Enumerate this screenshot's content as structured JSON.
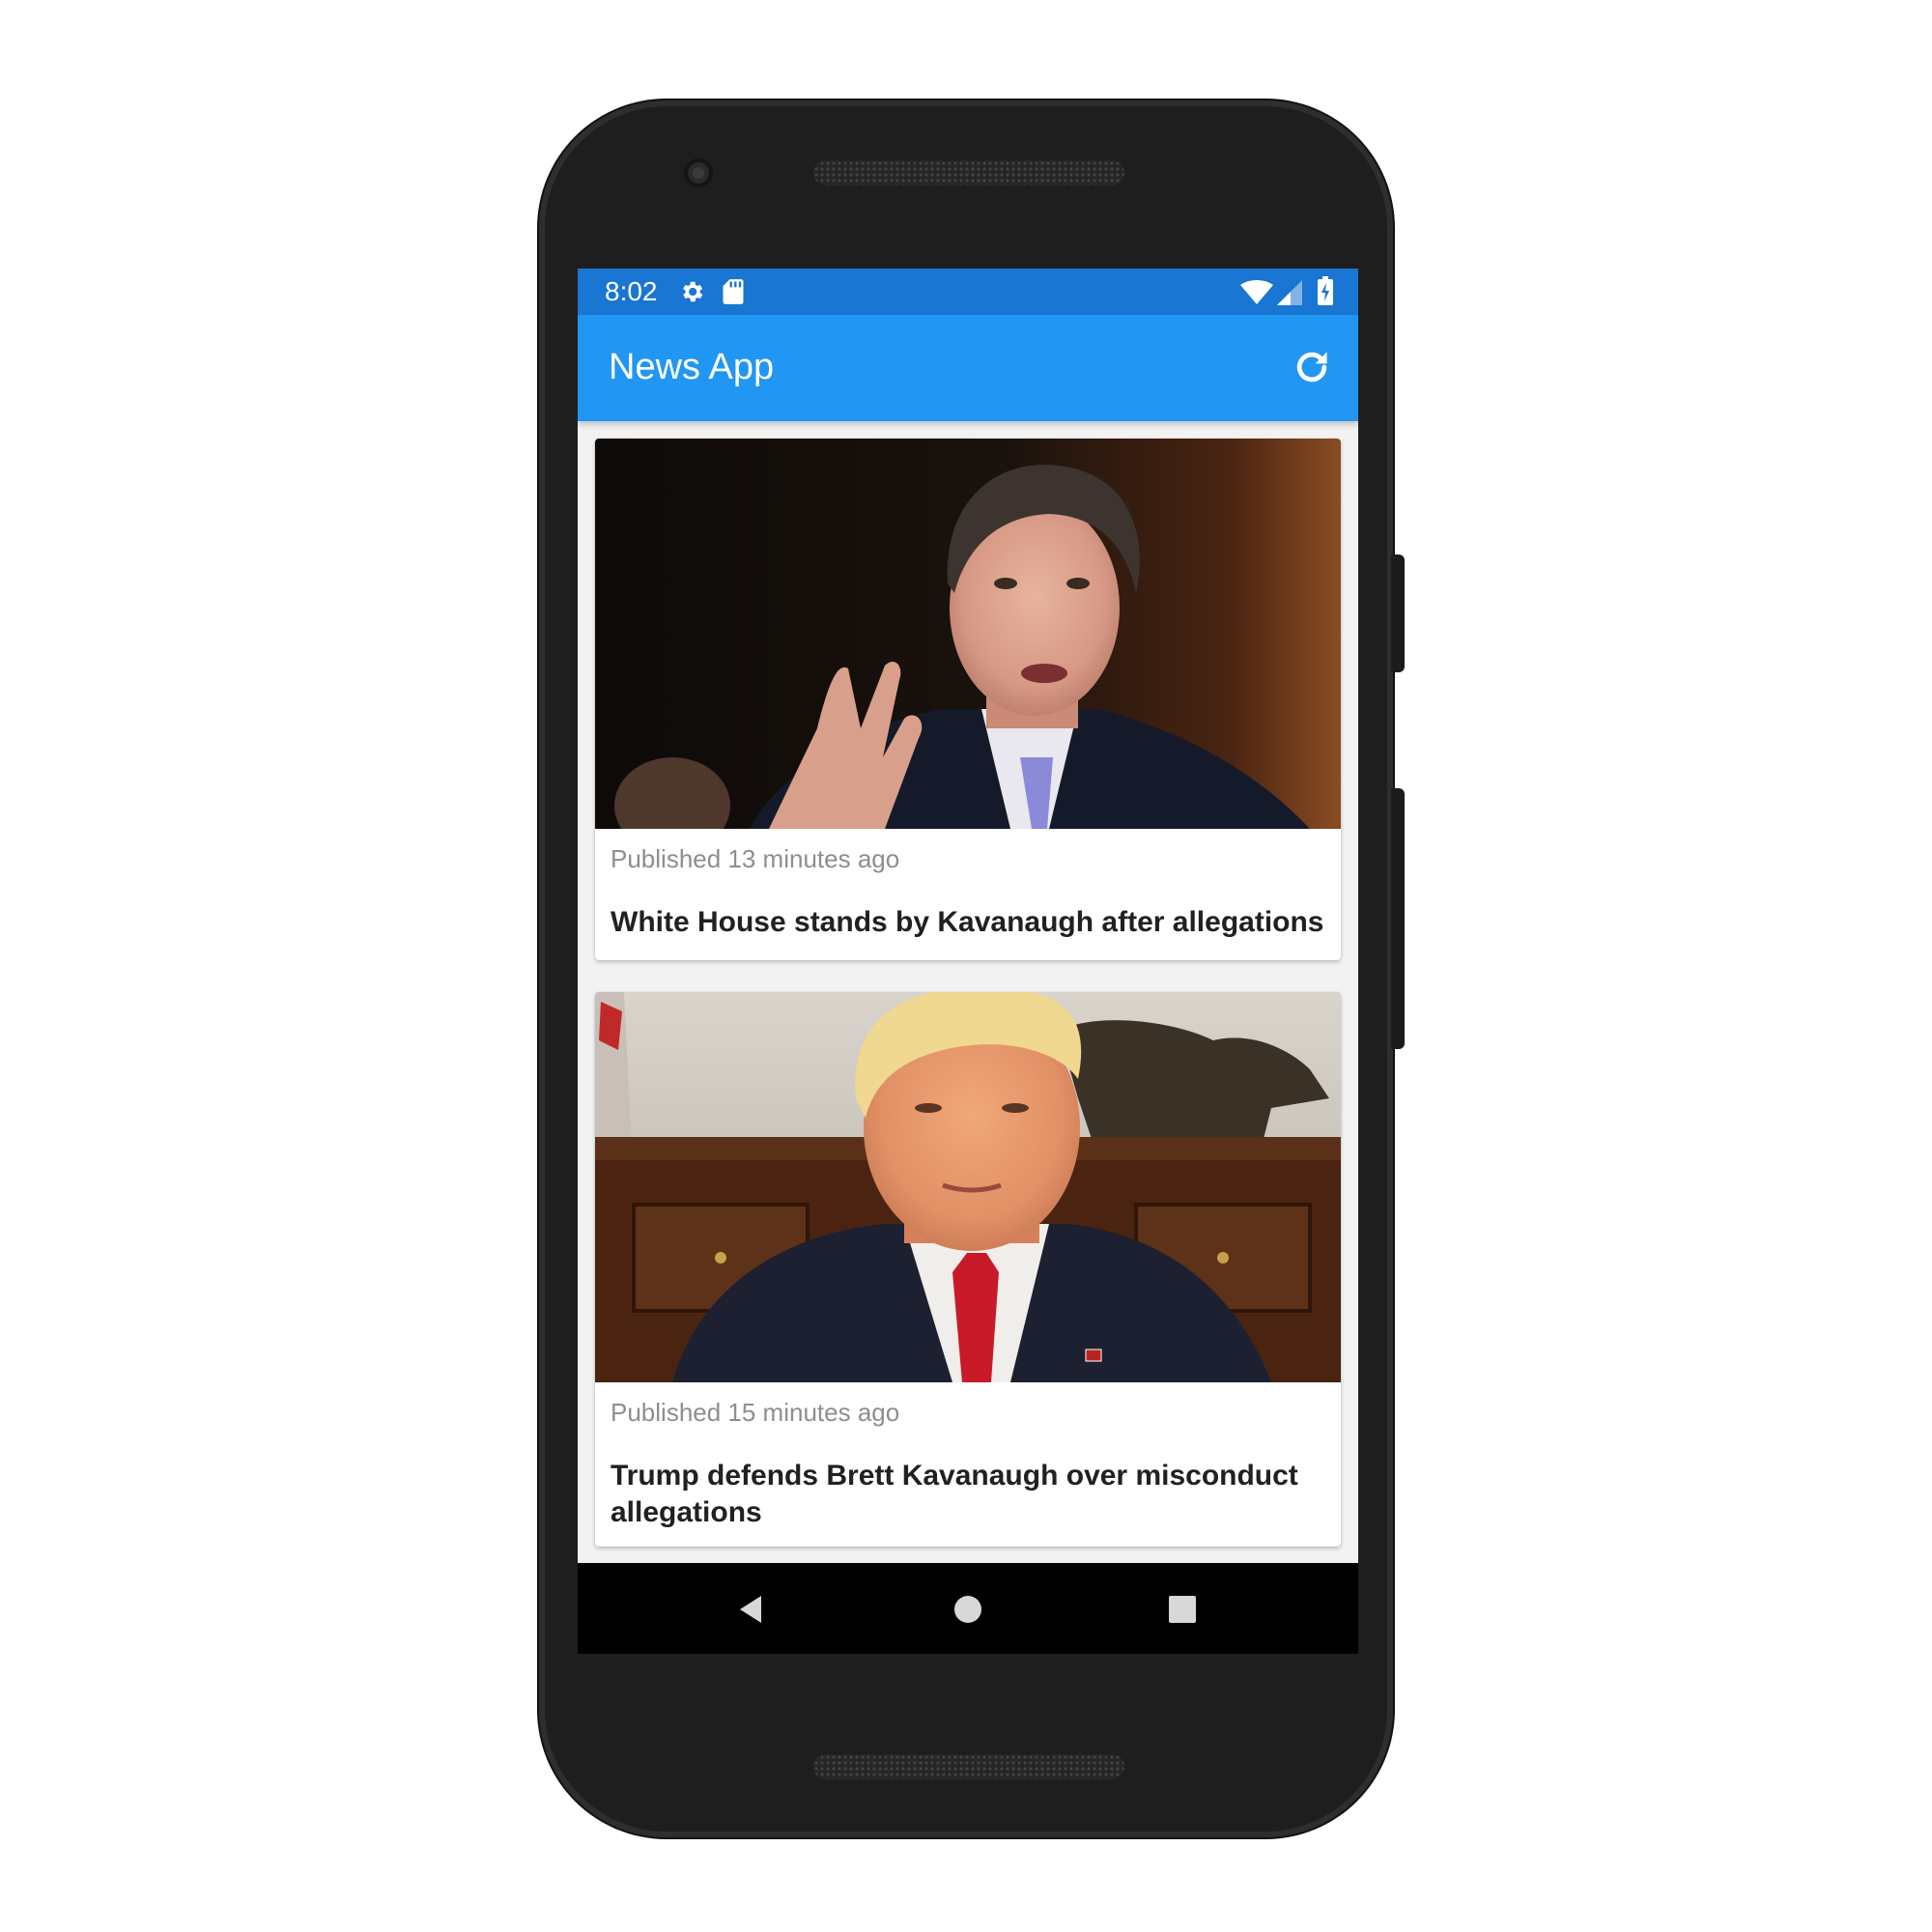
{
  "status_bar": {
    "time": "8:02",
    "background": "#1976d2",
    "icons": [
      "gear-icon",
      "sd-card-icon",
      "wifi-icon",
      "cell-signal-icon",
      "battery-charging-icon"
    ]
  },
  "app_bar": {
    "title": "News App",
    "background": "#2196f3",
    "action_icon": "refresh-icon"
  },
  "articles": [
    {
      "published": "Published 13 minutes ago",
      "title": "White House stands by Kavanaugh after allegations",
      "image": "photo-of-man-speaking-at-hearing"
    },
    {
      "published": "Published 15 minutes ago",
      "title": "Trump defends Brett Kavanaugh over misconduct allegations",
      "image": "photo-of-man-in-suit-red-tie"
    }
  ],
  "nav_bar": {
    "buttons": [
      "back-icon",
      "home-icon",
      "recents-icon"
    ]
  }
}
